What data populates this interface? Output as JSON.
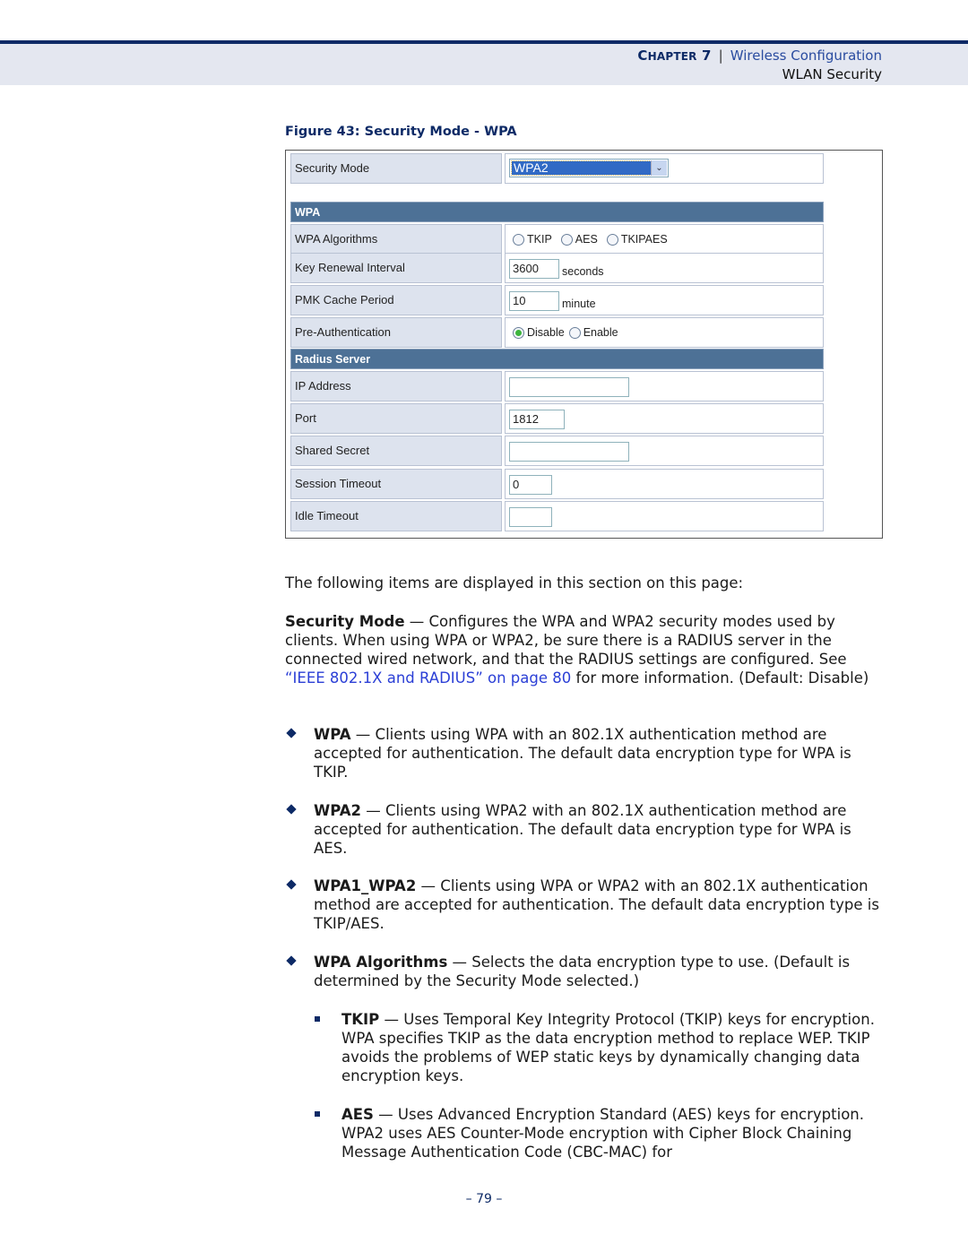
{
  "header": {
    "chapter_prefix_big": "C",
    "chapter_prefix_small": "HAPTER",
    "chapter_number": "7",
    "separator": "|",
    "chapter_title": "Wireless Configuration",
    "section_title": "WLAN Security"
  },
  "figure": {
    "caption": "Figure 43:  Security Mode - WPA",
    "security_mode": {
      "label": "Security Mode",
      "selected": "WPA2",
      "arrow": "⌄"
    },
    "wpa_section": {
      "title": "WPA",
      "algorithms": {
        "label": "WPA Algorithms",
        "options": [
          "TKIP",
          "AES",
          "TKIPAES"
        ]
      },
      "key_renewal": {
        "label": "Key Renewal Interval",
        "value": "3600",
        "unit": "seconds"
      },
      "pmk_cache": {
        "label": "PMK Cache Period",
        "value": "10",
        "unit": "minute"
      },
      "pre_auth": {
        "label": "Pre-Authentication",
        "options": [
          "Disable",
          "Enable"
        ],
        "selected": "Disable"
      }
    },
    "radius_section": {
      "title": "Radius Server",
      "ip_address": {
        "label": "IP Address",
        "value": ""
      },
      "port": {
        "label": "Port",
        "value": "1812"
      },
      "shared_secret": {
        "label": "Shared Secret",
        "value": ""
      },
      "session_timeout": {
        "label": "Session Timeout",
        "value": "0"
      },
      "idle_timeout": {
        "label": "Idle Timeout",
        "value": ""
      }
    }
  },
  "body": {
    "intro": "The following items are displayed in this section on this page:",
    "security_mode": {
      "term": "Security Mode",
      "text_before_link": " — Configures the WPA and WPA2 security modes used by clients. When using WPA or WPA2, be sure there is a RADIUS server in the connected wired network, and that the RADIUS settings are configured. See ",
      "link": "“IEEE 802.1X and RADIUS” on page 80",
      "text_after_link": " for more information. (Default: Disable)"
    },
    "bullets": [
      {
        "term": "WPA",
        "text": " — Clients using WPA with an 802.1X authentication method are accepted for authentication. The default data encryption type for WPA is TKIP."
      },
      {
        "term": "WPA2",
        "text": " — Clients using WPA2 with an 802.1X authentication method are accepted for authentication. The default data encryption type for WPA is AES."
      },
      {
        "term": "WPA1_WPA2",
        "text": " — Clients using WPA or WPA2 with an 802.1X authentication method are accepted for authentication. The default data encryption type is TKIP/AES."
      },
      {
        "term": "WPA Algorithms",
        "text": " — Selects the data encryption type to use. (Default is determined by the Security Mode selected.)"
      }
    ],
    "sub_bullets": [
      {
        "term": "TKIP",
        "text": " — Uses Temporal Key Integrity Protocol (TKIP) keys for encryption. WPA specifies TKIP as the data encryption method to replace WEP. TKIP avoids the problems of WEP static keys by dynamically changing data encryption keys."
      },
      {
        "term": "AES",
        "text": " — Uses Advanced Encryption Standard (AES) keys for encryption. WPA2 uses AES Counter-Mode encryption with Cipher Block Chaining Message Authentication Code (CBC-MAC) for"
      }
    ]
  },
  "footer": {
    "page_number": "–  79  –"
  },
  "colors": {
    "brand_navy": "#0d2a66",
    "link_blue": "#2b3fd6",
    "section_bar": "#4d7196",
    "label_bg": "#dde3ee",
    "select_highlight": "#316ac5"
  }
}
